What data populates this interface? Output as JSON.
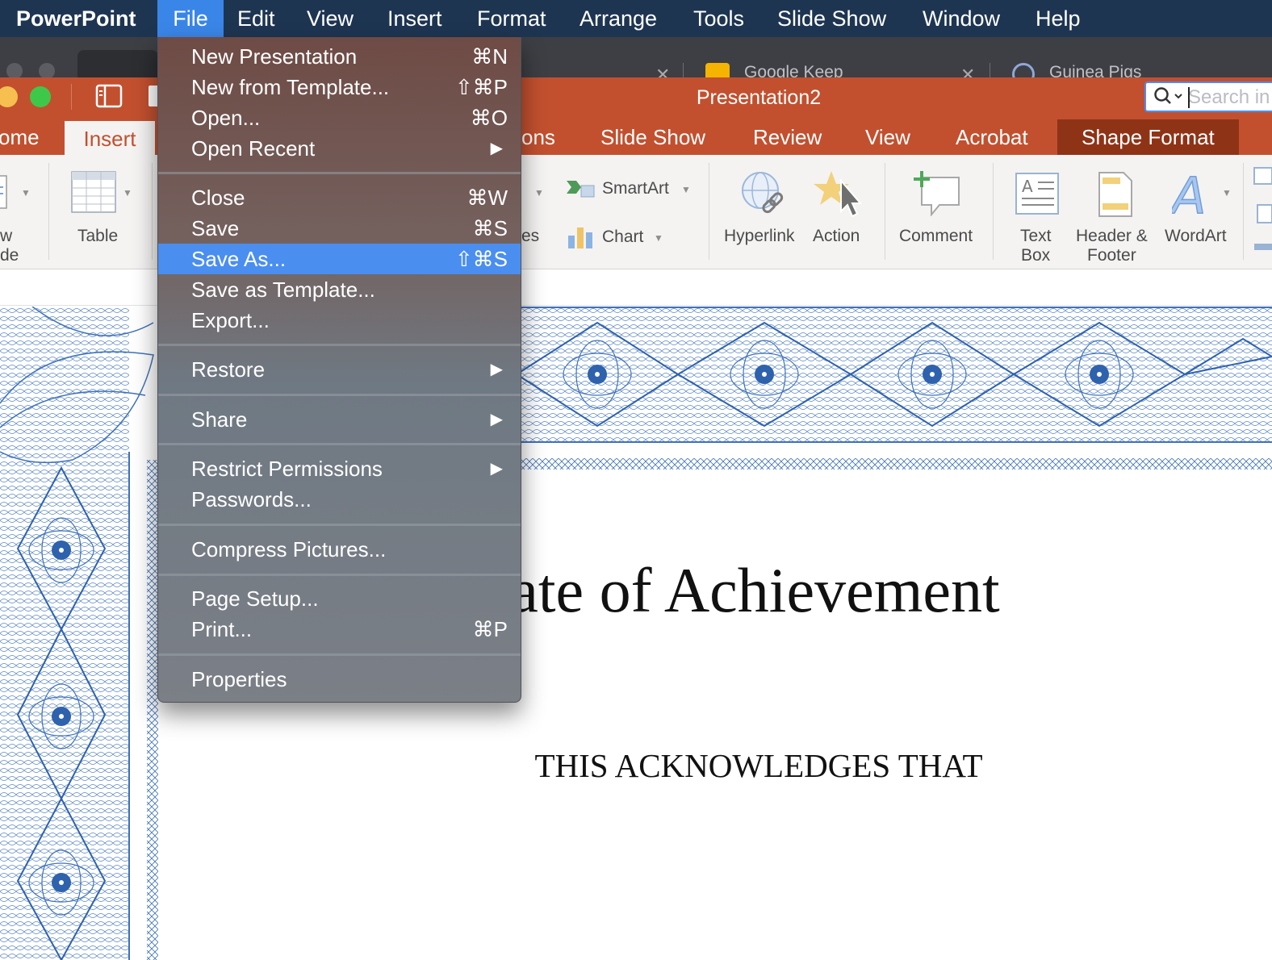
{
  "menubar": {
    "app": "PowerPoint",
    "items": [
      "File",
      "Edit",
      "View",
      "Insert",
      "Format",
      "Arrange",
      "Tools",
      "Slide Show",
      "Window",
      "Help"
    ]
  },
  "browser": {
    "tabs": [
      "Google Keep",
      "Guinea Pigs"
    ]
  },
  "window": {
    "title": "Presentation2",
    "search_placeholder": "Search in Presentation"
  },
  "ribbon_tabs": [
    "ome",
    "Insert",
    "ons",
    "Slide Show",
    "Review",
    "View",
    "Acrobat",
    "Shape Format"
  ],
  "ribbon": {
    "new_slide_label_1": "w",
    "new_slide_label_2": "de",
    "table": "Table",
    "smartart": "SmartArt",
    "chart": "Chart",
    "shapes_partial": "es",
    "hyperlink": "Hyperlink",
    "action": "Action",
    "comment": "Comment",
    "textbox_1": "Text",
    "textbox_2": "Box",
    "header_1": "Header &",
    "header_2": "Footer",
    "wordart": "WordArt"
  },
  "slide": {
    "title": "ficate of Achievement",
    "subtitle": "THIS ACKNOWLEDGES THAT"
  },
  "file_menu": {
    "new_presentation": {
      "label": "New Presentation",
      "shortcut": "⌘N"
    },
    "new_from_template": {
      "label": "New from Template...",
      "shortcut": "⇧⌘P"
    },
    "open": {
      "label": "Open...",
      "shortcut": "⌘O"
    },
    "open_recent": {
      "label": "Open Recent"
    },
    "close": {
      "label": "Close",
      "shortcut": "⌘W"
    },
    "save": {
      "label": "Save",
      "shortcut": "⌘S"
    },
    "save_as": {
      "label": "Save As...",
      "shortcut": "⇧⌘S"
    },
    "save_as_template": {
      "label": "Save as Template..."
    },
    "export": {
      "label": "Export..."
    },
    "restore": {
      "label": "Restore"
    },
    "share": {
      "label": "Share"
    },
    "restrict_permissions": {
      "label": "Restrict Permissions"
    },
    "passwords": {
      "label": "Passwords..."
    },
    "compress_pictures": {
      "label": "Compress Pictures..."
    },
    "page_setup": {
      "label": "Page Setup..."
    },
    "print": {
      "label": "Print...",
      "shortcut": "⌘P"
    },
    "properties": {
      "label": "Properties"
    }
  },
  "colors": {
    "menubar": "#1e3552",
    "menubar_active": "#3a86e8",
    "titlebar": "#c2502f",
    "shape_format_tab": "#8f3317",
    "menu_highlight": "#4a8ef0",
    "guilloche_blue": "#3f72b9"
  },
  "icons": {
    "submenu": "triangle-right-icon",
    "search": "magnifier-icon"
  }
}
